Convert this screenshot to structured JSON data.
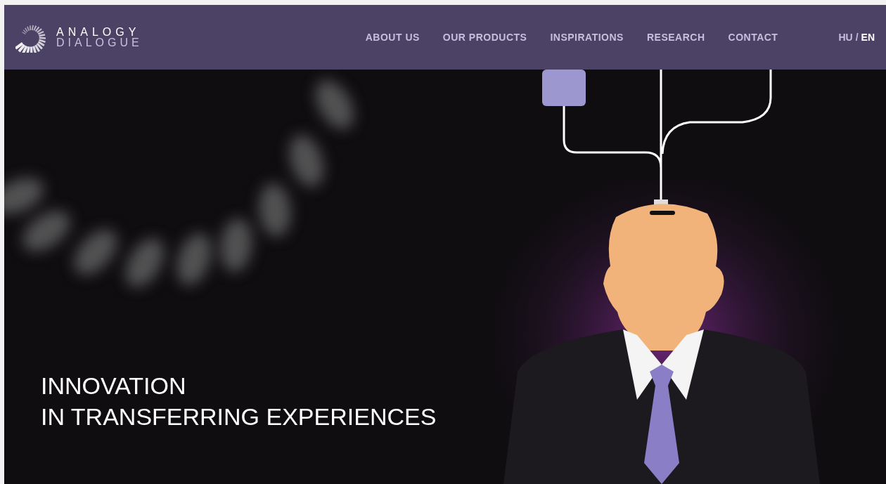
{
  "brand": {
    "line_1": "ANALOGY",
    "line_2": "DIALOGUE"
  },
  "nav": [
    {
      "label": "ABOUT US"
    },
    {
      "label": "OUR PRODUCTS"
    },
    {
      "label": "INSPIRATIONS"
    },
    {
      "label": "RESEARCH"
    },
    {
      "label": "CONTACT"
    }
  ],
  "languages": [
    {
      "label": "HU",
      "selected": false
    },
    {
      "label": "EN",
      "selected": true
    }
  ],
  "language_separator": "/",
  "hero": {
    "headline": [
      "INNOVATION",
      "IN TRANSFERRING EXPERIENCES"
    ]
  }
}
